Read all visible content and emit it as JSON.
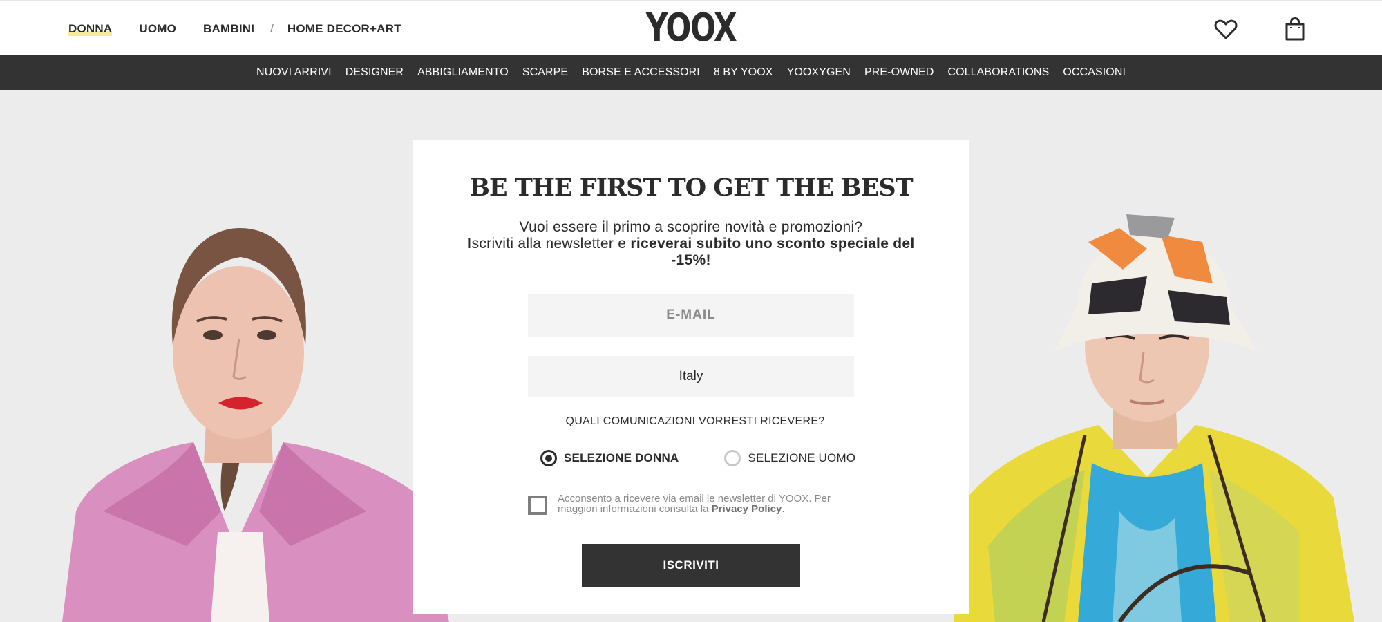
{
  "header": {
    "logo": "YOOX",
    "gender_nav": [
      {
        "label": "DONNA",
        "active": true
      },
      {
        "label": "UOMO",
        "active": false
      },
      {
        "label": "BAMBINI",
        "active": false
      }
    ],
    "separator": "/",
    "home_decor": "HOME DECOR+ART",
    "icons": [
      "heart-icon",
      "shopping-bag-icon"
    ]
  },
  "category_nav": [
    "NUOVI ARRIVI",
    "DESIGNER",
    "ABBIGLIAMENTO",
    "SCARPE",
    "BORSE E ACCESSORI",
    "8 BY YOOX",
    "YOOXYGEN",
    "PRE-OWNED",
    "COLLABORATIONS",
    "OCCASIONI"
  ],
  "newsletter": {
    "title": "BE THE FIRST TO GET THE BEST",
    "subtitle_line1": "Vuoi essere il primo a scoprire novità e promozioni?",
    "subtitle_line2_prefix": "Iscriviti alla newsletter e ",
    "subtitle_line2_bold": "riceverai subito uno sconto speciale del -15%!",
    "email_placeholder": "E-MAIL",
    "country": "Italy",
    "question": "QUALI COMUNICAZIONI VORRESTI RICEVERE?",
    "options": [
      {
        "label": "SELEZIONE DONNA",
        "selected": true
      },
      {
        "label": "SELEZIONE UOMO",
        "selected": false
      }
    ],
    "consent_text": "Acconsento a ricevere via email le newsletter di YOOX. Per maggiori informazioni consulta la ",
    "consent_link": "Privacy Policy",
    "consent_suffix": ".",
    "consent_checked": false,
    "submit_label": "ISCRIVITI"
  },
  "colors": {
    "dark": "#333333",
    "page_background": "#ececec",
    "active_highlight": "#f4ec9c"
  }
}
